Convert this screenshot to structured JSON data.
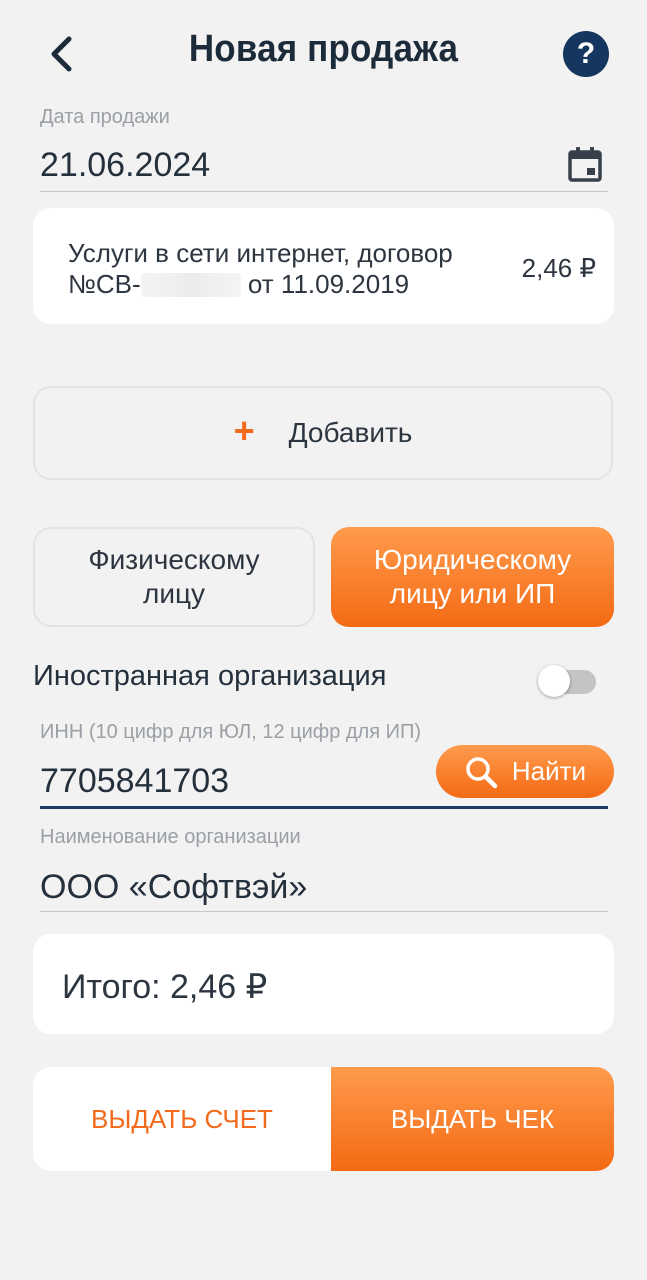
{
  "header": {
    "title": "Новая продажа",
    "help_symbol": "?"
  },
  "sale_date": {
    "label": "Дата продажи",
    "value": "21.06.2024"
  },
  "service_item": {
    "line1": "Услуги в сети интернет, договор",
    "line2_prefix": "№СВ-",
    "line2_suffix": "от 11.09.2019",
    "price": "2,46 ₽"
  },
  "add_button": {
    "plus": "+",
    "label": "Добавить"
  },
  "customer_type": {
    "individual_line1": "Физическому",
    "individual_line2": "лицу",
    "legal_line1": "Юридическому",
    "legal_line2": "лицу или ИП"
  },
  "foreign_org": {
    "label": "Иностранная организация",
    "enabled": false
  },
  "inn": {
    "label": "ИНН (10 цифр для ЮЛ, 12 цифр для ИП)",
    "value": "7705841703",
    "find_label": "Найти"
  },
  "org_name": {
    "label": "Наименование организации",
    "value": "ООО «Софтвэй»"
  },
  "total": {
    "label": "Итого: 2,46 ₽"
  },
  "actions": {
    "invoice_label": "ВЫДАТЬ СЧЕТ",
    "receipt_label": "ВЫДАТЬ ЧЕК"
  },
  "colors": {
    "accent_orange": "#f46a14",
    "navy": "#14365f",
    "background": "#f2f2f2"
  }
}
